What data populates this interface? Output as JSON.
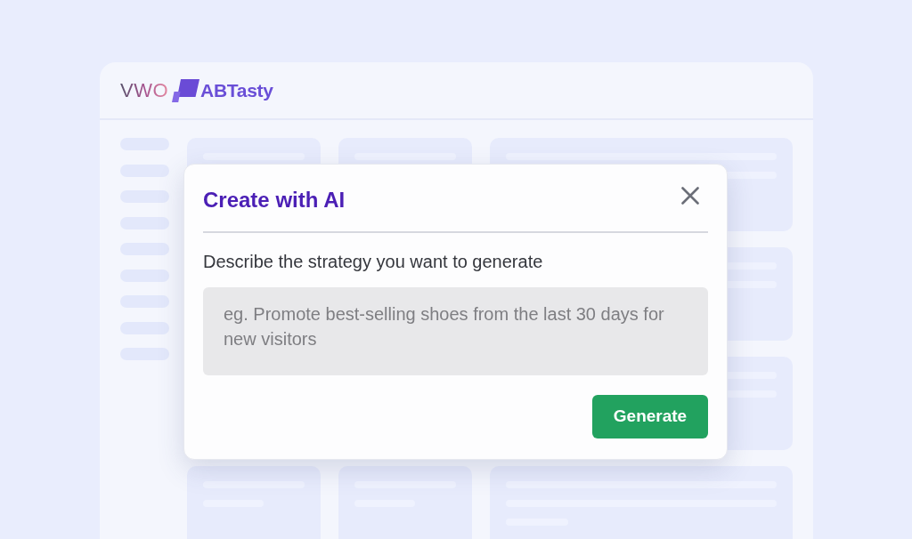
{
  "header": {
    "logos": [
      {
        "kind": "gradient",
        "text": "VWO"
      },
      {
        "kind": "with_mark",
        "text": "ABTasty"
      }
    ]
  },
  "dialog": {
    "title": "Create with AI",
    "prompt_label": "Describe the strategy you want to generate",
    "input": {
      "placeholder": "eg. Promote best-selling shoes from the last 30 days for new visitors"
    },
    "buttons": [
      "Generate"
    ]
  }
}
